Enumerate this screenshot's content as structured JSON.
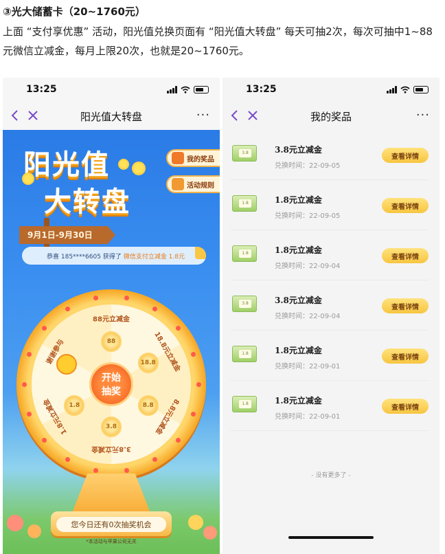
{
  "article": {
    "title": "③光大储蓄卡（20~1760元）",
    "paragraph": "上面 “支付享优惠” 活动，阳光值兑换页面有 “阳光值大转盘” 每天可抽2次，每次可抽中1~88元微信立减金，每月上限20次，也就是20~1760元。"
  },
  "left_phone": {
    "status_time": "13:25",
    "nav_title": "阳光值大转盘",
    "more": "···",
    "logo_line1": "阳光值",
    "logo_line2": "大转盘",
    "my_prizes_btn": "我的奖品",
    "rules_btn": "活动规则",
    "date_range": "9月1日-9月30日",
    "ticker_text": "恭喜 185****6605 获得了",
    "ticker_prize": "微信支付立减金 1.8元",
    "wheel": {
      "segments": [
        "88元立减金",
        "18.8元立减金",
        "8.8元立减金",
        "3.8元立减金",
        "1.8元立减金",
        "谢谢参与"
      ],
      "coins": [
        "88",
        "18.8",
        "8.8",
        "3.8",
        "1.8"
      ],
      "center_line1": "开始",
      "center_line2": "抽奖"
    },
    "chances_text": "您今日还有0次抽奖机会",
    "disclaimer": "*本活动与苹果公司无关"
  },
  "right_phone": {
    "status_time": "13:25",
    "nav_title": "我的奖品",
    "more": "···",
    "prizes": [
      {
        "thumb": "3.8",
        "name": "3.8元立减金",
        "date": "兑换时间：22-09-05",
        "button": "查看详情"
      },
      {
        "thumb": "1.8",
        "name": "1.8元立减金",
        "date": "兑换时间：22-09-05",
        "button": "查看详情"
      },
      {
        "thumb": "1.8",
        "name": "1.8元立减金",
        "date": "兑换时间：22-09-04",
        "button": "查看详情"
      },
      {
        "thumb": "3.8",
        "name": "3.8元立减金",
        "date": "兑换时间：22-09-04",
        "button": "查看详情"
      },
      {
        "thumb": "1.8",
        "name": "1.8元立减金",
        "date": "兑换时间：22-09-01",
        "button": "查看详情"
      },
      {
        "thumb": "1.8",
        "name": "1.8元立减金",
        "date": "兑换时间：22-09-01",
        "button": "查看详情"
      }
    ],
    "no_more": "- 没有更多了 -"
  }
}
